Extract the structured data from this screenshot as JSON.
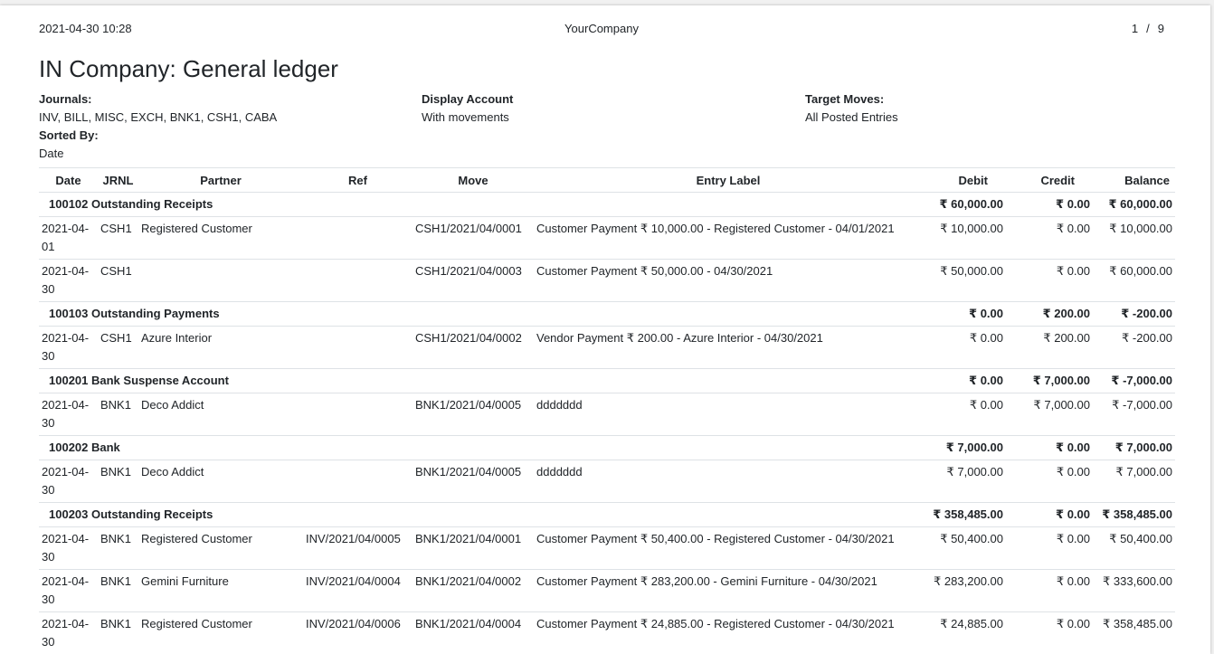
{
  "header": {
    "printed_at": "2021-04-30 10:28",
    "company": "YourCompany",
    "page_current": "1",
    "page_sep": "/",
    "page_total": "9"
  },
  "report_title": "IN Company: General ledger",
  "filters": {
    "journals_label": "Journals:",
    "journals_value": "INV, BILL, MISC, EXCH, BNK1, CSH1, CABA",
    "display_account_label": "Display Account",
    "display_account_value": "With movements",
    "target_moves_label": "Target Moves:",
    "target_moves_value": "All Posted Entries",
    "sorted_by_label": "Sorted By:",
    "sorted_by_value": "Date"
  },
  "columns": {
    "date": "Date",
    "jrnl": "JRNL",
    "partner": "Partner",
    "ref": "Ref",
    "move": "Move",
    "entry_label": "Entry Label",
    "debit": "Debit",
    "credit": "Credit",
    "balance": "Balance"
  },
  "accounts": [
    {
      "name": "100102 Outstanding Receipts",
      "debit": "₹ 60,000.00",
      "credit": "₹ 0.00",
      "balance": "₹ 60,000.00",
      "lines": [
        {
          "date": "2021-04-01",
          "jrnl": "CSH1",
          "partner": "Registered Customer",
          "ref": "",
          "move": "CSH1/2021/04/0001",
          "label": "Customer Payment ₹ 10,000.00 - Registered Customer - 04/01/2021",
          "debit": "₹ 10,000.00",
          "credit": "₹ 0.00",
          "balance": "₹ 10,000.00"
        },
        {
          "date": "2021-04-30",
          "jrnl": "CSH1",
          "partner": "",
          "ref": "",
          "move": "CSH1/2021/04/0003",
          "label": "Customer Payment ₹ 50,000.00 - 04/30/2021",
          "debit": "₹ 50,000.00",
          "credit": "₹ 0.00",
          "balance": "₹ 60,000.00"
        }
      ]
    },
    {
      "name": "100103 Outstanding Payments",
      "debit": "₹ 0.00",
      "credit": "₹ 200.00",
      "balance": "₹ -200.00",
      "lines": [
        {
          "date": "2021-04-30",
          "jrnl": "CSH1",
          "partner": "Azure Interior",
          "ref": "",
          "move": "CSH1/2021/04/0002",
          "label": "Vendor Payment ₹ 200.00 - Azure Interior - 04/30/2021",
          "debit": "₹ 0.00",
          "credit": "₹ 200.00",
          "balance": "₹ -200.00"
        }
      ]
    },
    {
      "name": "100201 Bank Suspense Account",
      "debit": "₹ 0.00",
      "credit": "₹ 7,000.00",
      "balance": "₹ -7,000.00",
      "lines": [
        {
          "date": "2021-04-30",
          "jrnl": "BNK1",
          "partner": "Deco Addict",
          "ref": "",
          "move": "BNK1/2021/04/0005",
          "label": "ddddddd",
          "debit": "₹ 0.00",
          "credit": "₹ 7,000.00",
          "balance": "₹ -7,000.00"
        }
      ]
    },
    {
      "name": "100202 Bank",
      "debit": "₹ 7,000.00",
      "credit": "₹ 0.00",
      "balance": "₹ 7,000.00",
      "lines": [
        {
          "date": "2021-04-30",
          "jrnl": "BNK1",
          "partner": "Deco Addict",
          "ref": "",
          "move": "BNK1/2021/04/0005",
          "label": "ddddddd",
          "debit": "₹ 7,000.00",
          "credit": "₹ 0.00",
          "balance": "₹ 7,000.00"
        }
      ]
    },
    {
      "name": "100203 Outstanding Receipts",
      "debit": "₹ 358,485.00",
      "credit": "₹ 0.00",
      "balance": "₹ 358,485.00",
      "lines": [
        {
          "date": "2021-04-30",
          "jrnl": "BNK1",
          "partner": "Registered Customer",
          "ref": "INV/2021/04/0005",
          "move": "BNK1/2021/04/0001",
          "label": "Customer Payment ₹ 50,400.00 - Registered Customer - 04/30/2021",
          "debit": "₹ 50,400.00",
          "credit": "₹ 0.00",
          "balance": "₹ 50,400.00"
        },
        {
          "date": "2021-04-30",
          "jrnl": "BNK1",
          "partner": "Gemini Furniture",
          "ref": "INV/2021/04/0004",
          "move": "BNK1/2021/04/0002",
          "label": "Customer Payment ₹ 283,200.00 - Gemini Furniture - 04/30/2021",
          "debit": "₹ 283,200.00",
          "credit": "₹ 0.00",
          "balance": "₹ 333,600.00"
        },
        {
          "date": "2021-04-30",
          "jrnl": "BNK1",
          "partner": "Registered Customer",
          "ref": "INV/2021/04/0006",
          "move": "BNK1/2021/04/0004",
          "label": "Customer Payment ₹ 24,885.00 - Registered Customer - 04/30/2021",
          "debit": "₹ 24,885.00",
          "credit": "₹ 0.00",
          "balance": "₹ 358,485.00"
        }
      ]
    }
  ]
}
